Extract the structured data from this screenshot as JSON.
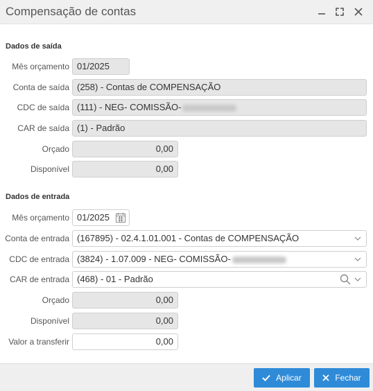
{
  "window": {
    "title": "Compensação de contas"
  },
  "saida": {
    "section_title": "Dados de saída",
    "mes_label": "Mês orçamento",
    "mes_value": "01/2025",
    "conta_label": "Conta de saída",
    "conta_value": "(258) - Contas de COMPENSAÇÃO",
    "cdc_label": "CDC de saída",
    "cdc_value": "(111) - NEG- COMISSÃO-",
    "car_label": "CAR de saída",
    "car_value": "(1) - Padrão",
    "orcado_label": "Orçado",
    "orcado_value": "0,00",
    "disponivel_label": "Disponível",
    "disponivel_value": "0,00"
  },
  "entrada": {
    "section_title": "Dados de entrada",
    "mes_label": "Mês orçamento",
    "mes_value": "01/2025",
    "conta_label": "Conta de entrada",
    "conta_value": "(167895) - 02.4.1.01.001 - Contas de COMPENSAÇÃO",
    "cdc_label": "CDC de entrada",
    "cdc_value": "(3824) - 1.07.009 - NEG- COMISSÃO-",
    "car_label": "CAR de entrada",
    "car_value": "(468) - 01 - Padrão",
    "orcado_label": "Orçado",
    "orcado_value": "0,00",
    "disponivel_label": "Disponível",
    "disponivel_value": "0,00",
    "valor_label": "Valor a transferir",
    "valor_value": "0,00"
  },
  "footer": {
    "apply_label": "Aplicar",
    "close_label": "Fechar"
  },
  "colors": {
    "accent": "#2f8bd8",
    "readonly_bg": "#e6e6e6"
  }
}
